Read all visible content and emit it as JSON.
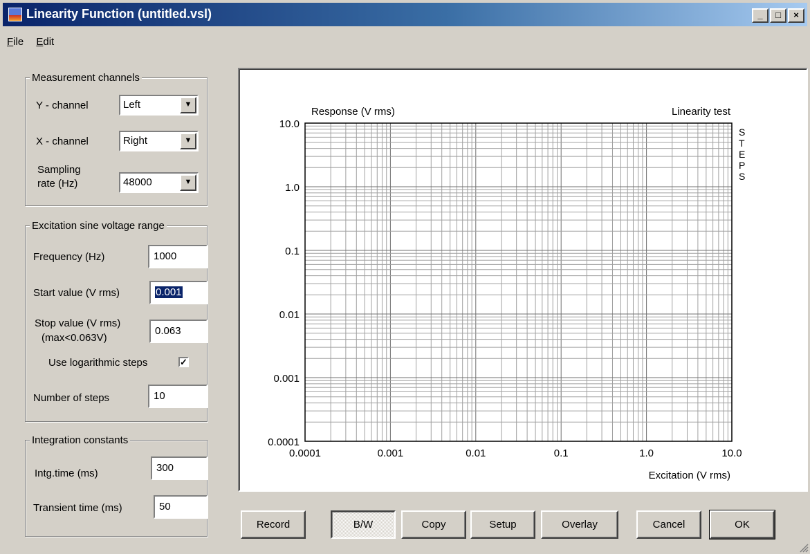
{
  "window": {
    "title": "Linearity Function (untitled.vsl)",
    "controls": {
      "minimize": "_",
      "maximize": "□",
      "close": "×"
    }
  },
  "menu": [
    {
      "label": "File",
      "underline": "F",
      "rest": "ile"
    },
    {
      "label": "Edit",
      "underline": "E",
      "rest": "dit"
    }
  ],
  "measurement": {
    "legend": "Measurement channels",
    "y_label": "Y - channel",
    "y_value": "Left",
    "x_label": "X - channel",
    "x_value": "Right",
    "rate_label_1": "Sampling",
    "rate_label_2": "rate (Hz)",
    "rate_value": "48000"
  },
  "excitation": {
    "legend": "Excitation sine voltage range",
    "freq_label": "Frequency (Hz)",
    "freq_value": "1000",
    "start_label": "Start value (V rms)",
    "start_value": "0.001",
    "stop_label_1": "Stop value (V rms)",
    "stop_label_2": "(max<0.063V)",
    "stop_value": "0.063",
    "log_label": "Use logarithmic steps",
    "log_checked": true,
    "log_mark": "✓",
    "steps_label": "Number of steps",
    "steps_value": "10"
  },
  "integration": {
    "legend": "Integration constants",
    "intg_label": "Intg.time (ms)",
    "intg_value": "300",
    "transient_label": "Transient time (ms)",
    "transient_value": "50"
  },
  "buttons": {
    "record": "Record",
    "bw": "B/W",
    "copy": "Copy",
    "setup": "Setup",
    "overlay": "Overlay",
    "cancel": "Cancel",
    "ok": "OK"
  },
  "chart_data": {
    "type": "line",
    "title": "Linearity test",
    "ylabel": "Response (V rms)",
    "xlabel": "Excitation (V rms)",
    "side_label": "STEPS",
    "x_scale": "log",
    "y_scale": "log",
    "xlim": [
      0.0001,
      10
    ],
    "ylim": [
      0.0001,
      10
    ],
    "x_ticks": [
      0.0001,
      0.001,
      0.01,
      0.1,
      1,
      10
    ],
    "x_tick_labels": [
      "0.0001",
      "0.001",
      "0.01",
      "0.1",
      "1.0",
      "10.0"
    ],
    "y_ticks": [
      10,
      1,
      0.1,
      0.01,
      0.001,
      0.0001
    ],
    "y_tick_labels": [
      "10.0",
      "1.0",
      "0.1",
      "0.01",
      "0.001",
      "0.0001"
    ],
    "grid": true,
    "series": []
  }
}
